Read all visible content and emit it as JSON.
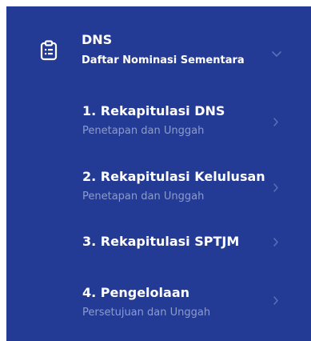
{
  "menu": {
    "parent": {
      "icon": "clipboard-list-icon",
      "title": "DNS",
      "subtitle": "Daftar Nominasi Sementara",
      "expand_icon": "chevron-down-icon"
    },
    "items": [
      {
        "label": "1. Rekapitulasi DNS",
        "description": "Penetapan dan Unggah",
        "icon": "chevron-right-icon"
      },
      {
        "label": "2. Rekapitulasi Kelulusan",
        "description": "Penetapan dan Unggah",
        "icon": "chevron-right-icon"
      },
      {
        "label": "3. Rekapitulasi SPTJM",
        "description": "",
        "icon": "chevron-right-icon"
      },
      {
        "label": "4. Pengelolaan",
        "description": "Persetujuan dan Unggah",
        "icon": "chevron-right-icon"
      }
    ]
  },
  "colors": {
    "panel_background": "#243b96",
    "text_primary": "#ffffff",
    "text_secondary": "#8b9ccf",
    "chevron": "#5a6fb8"
  }
}
